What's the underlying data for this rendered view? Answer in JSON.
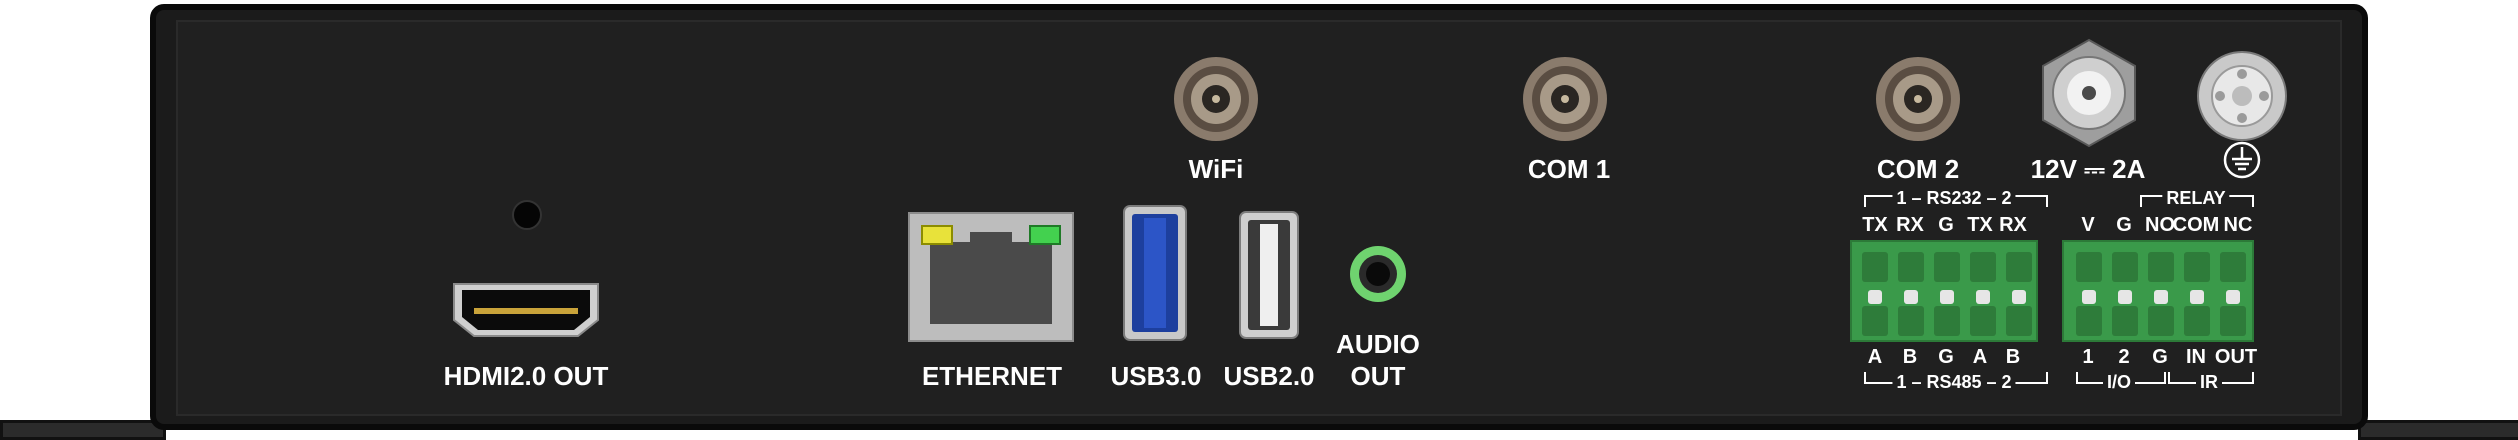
{
  "ports": {
    "hdmi": "HDMI2.0 OUT",
    "ethernet": "ETHERNET",
    "usb3": "USB3.0",
    "usb2": "USB2.0",
    "audio_line1": "AUDIO",
    "audio_line2": "OUT",
    "wifi": "WiFi",
    "com1": "COM 1",
    "com2": "COM 2",
    "power": "12V ⎓ 2A"
  },
  "rs232": {
    "header": "1 – RS232 – 2",
    "pins": [
      "TX",
      "RX",
      "G",
      "TX",
      "RX"
    ]
  },
  "rs485": {
    "footer": "1 – RS485 – 2",
    "pins": [
      "A",
      "B",
      "G",
      "A",
      "B"
    ]
  },
  "relay": {
    "header": "RELAY",
    "pins_top": [
      "V",
      "G",
      "NO",
      "COM",
      "NC"
    ]
  },
  "io_ir": {
    "pins_bottom": [
      "1",
      "2",
      "G",
      "IN",
      "OUT"
    ],
    "io_label": "I/O",
    "ir_label": "IR"
  },
  "icons": {
    "ground": "ground-icon"
  },
  "colors": {
    "chassis": "#1b1b1b",
    "terminal_green": "#3a9a4a",
    "led_yellow": "#e8e23a",
    "led_green": "#43d14f",
    "usb3_blue": "#1d3f9e",
    "audio_green": "#6fd36f"
  }
}
